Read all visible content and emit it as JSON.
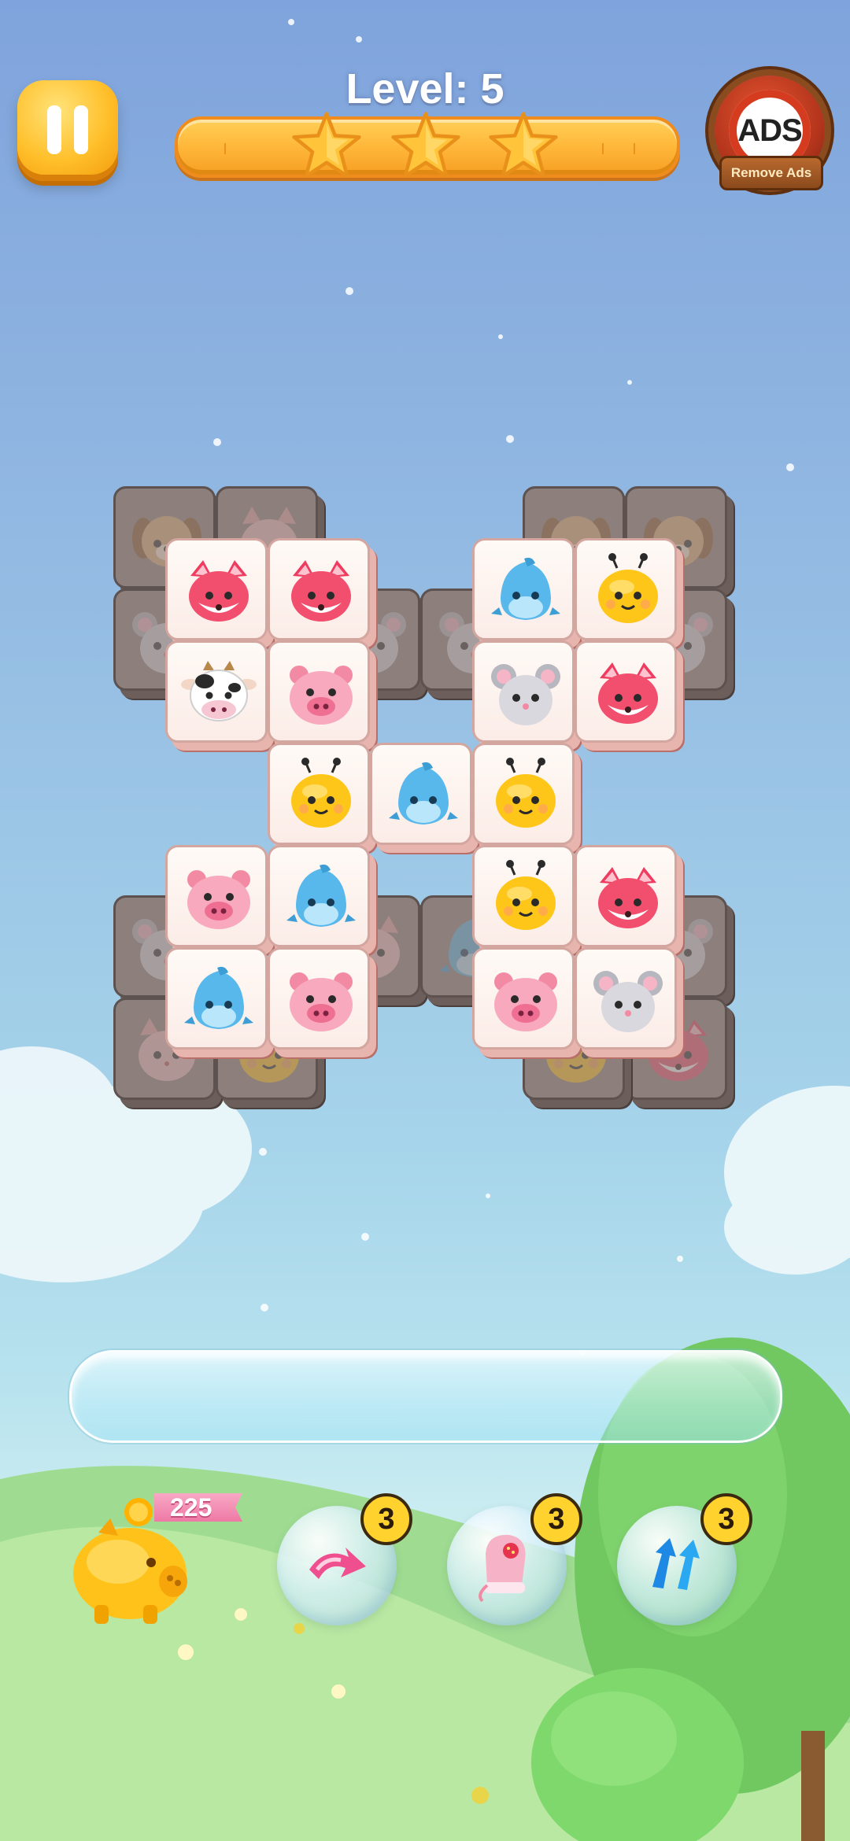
{
  "header": {
    "level_text": "Level: 5",
    "progress_stars": 3,
    "remove_ads_icon_text": "ADS",
    "remove_ads_label": "Remove Ads"
  },
  "board": {
    "top_tiles": [
      [
        "fox",
        "fox",
        null,
        "dolphin",
        "bee"
      ],
      [
        "cow",
        "pig",
        null,
        "mouse",
        "fox"
      ],
      [
        null,
        "bee",
        "dolphin",
        "bee",
        null
      ],
      [
        "pig",
        "dolphin",
        null,
        "bee",
        "fox"
      ],
      [
        "dolphin",
        "pig",
        null,
        "pig",
        "mouse"
      ]
    ],
    "bottom_tiles_visible": [
      "dog",
      "cat",
      "mouse",
      "dog",
      "dog",
      "mouse",
      "mouse",
      "cat",
      "mouse",
      "fox"
    ]
  },
  "tray": {
    "slots_filled": 0
  },
  "coins": {
    "value": "225"
  },
  "boosters": [
    {
      "name": "undo",
      "icon": "pink-arrow-icon",
      "count": "3"
    },
    {
      "name": "magic-glove",
      "icon": "mitten-icon",
      "count": "3"
    },
    {
      "name": "shuffle",
      "icon": "shuffle-arrows-icon",
      "count": "3"
    }
  ],
  "colors": {
    "pause_button": "#ffbf2a",
    "progress_bar": "#ffb73a",
    "tile_face": "#fdf3ee",
    "tile_locked": "#8c7f7c",
    "badge": "#ffd22e"
  }
}
